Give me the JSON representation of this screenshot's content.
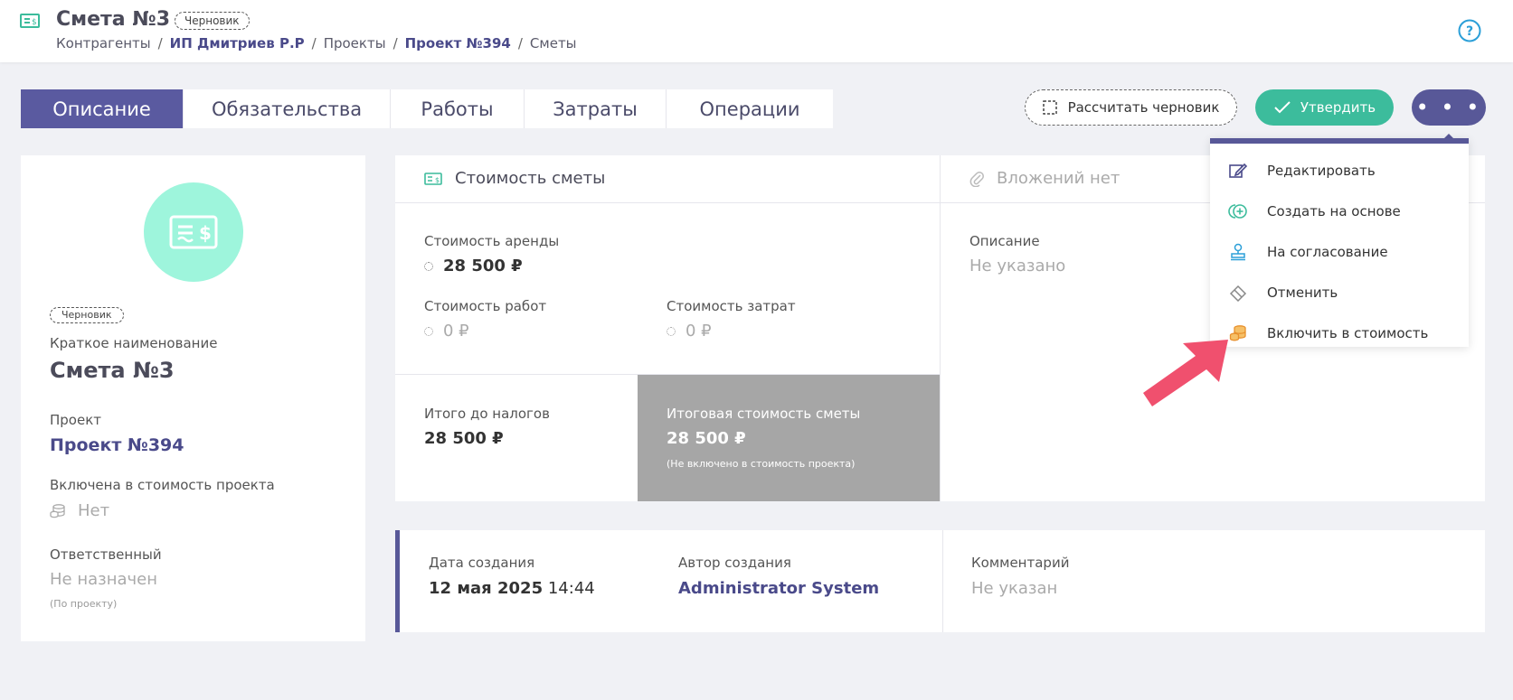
{
  "header": {
    "title": "Смета №3",
    "status_badge": "Черновик",
    "breadcrumb": [
      "Контрагенты",
      "ИП Дмитриев Р.Р",
      "Проекты",
      "Проект №394",
      "Сметы"
    ],
    "help_icon": "question-circle-icon"
  },
  "tabs": [
    {
      "label": "Описание",
      "active": true
    },
    {
      "label": "Обязательства",
      "active": false
    },
    {
      "label": "Работы",
      "active": false
    },
    {
      "label": "Затраты",
      "active": false
    },
    {
      "label": "Операции",
      "active": false
    }
  ],
  "actions": {
    "calc_draft_label": "Рассчитать черновик",
    "approve_label": "Утвердить",
    "more_label": "• • •"
  },
  "dropdown_menu": [
    {
      "label": "Редактировать",
      "icon": "edit-icon"
    },
    {
      "label": "Создать на основе",
      "icon": "create-based-icon"
    },
    {
      "label": "На согласование",
      "icon": "stamp-icon"
    },
    {
      "label": "Отменить",
      "icon": "eraser-icon"
    },
    {
      "label": "Включить в стоимость",
      "icon": "coins-icon"
    }
  ],
  "summary": {
    "status_badge": "Черновик",
    "short_name_label": "Краткое наименование",
    "short_name": "Смета №3",
    "project_label": "Проект",
    "project": "Проект №394",
    "included_label": "Включена в стоимость проекта",
    "included_value": "Нет",
    "responsible_label": "Ответственный",
    "responsible_value": "Не назначен",
    "responsible_note": "(По проекту)"
  },
  "cost": {
    "header": "Стоимость сметы",
    "rent_label": "Стоимость аренды",
    "rent_value": "28 500 ₽",
    "works_label": "Стоимость работ",
    "works_value": "0 ₽",
    "expenses_label": "Стоимость затрат",
    "expenses_value": "0 ₽",
    "pretax_label": "Итого до налогов",
    "pretax_value": "28 500 ₽",
    "total_label": "Итоговая стоимость сметы",
    "total_value": "28 500 ₽",
    "total_note": "(Не включено в стоимость проекта)"
  },
  "attachments": {
    "header": "Вложений нет",
    "description_label": "Описание",
    "description_value": "Не указано"
  },
  "meta": {
    "created_label": "Дата создания",
    "created_date": "12 мая 2025",
    "created_time": "14:44",
    "author_label": "Автор создания",
    "author": "Administrator System",
    "comment_label": "Комментарий",
    "comment_value": "Не указан"
  },
  "colors": {
    "accent": "#585898",
    "approve": "#3cbc9c",
    "avatar_bg": "#9ef5dc",
    "total_bg": "#a6a6a6",
    "arrow": "#f0506e"
  }
}
